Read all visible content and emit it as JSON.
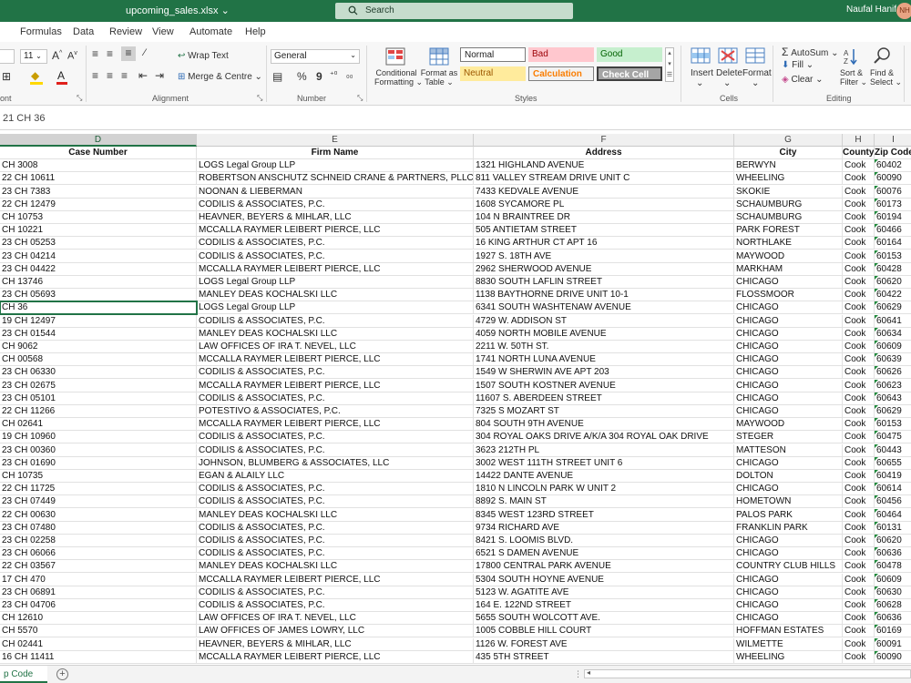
{
  "title_bar": {
    "file_name": "upcoming_sales.xlsx",
    "search_placeholder": "Search",
    "user_name": "Naufal Hanif",
    "user_initials": "NH"
  },
  "menu": [
    "Formulas",
    "Data",
    "Review",
    "View",
    "Automate",
    "Help"
  ],
  "ribbon": {
    "font_size": "11",
    "wrap_text": "Wrap Text",
    "merge_centre": "Merge & Centre",
    "number_format": "General",
    "currency_symbol": "%",
    "comma_symbol": "9",
    "conditional_formatting": [
      "Conditional",
      "Formatting"
    ],
    "format_as_table": [
      "Format as",
      "Table"
    ],
    "styles": {
      "normal": "Normal",
      "bad": "Bad",
      "good": "Good",
      "neutral": "Neutral",
      "calculation": "Calculation",
      "check_cell": "Check Cell"
    },
    "insert": "Insert",
    "delete": "Delete",
    "format": "Format",
    "autosum": "AutoSum",
    "fill": "Fill",
    "clear": "Clear",
    "sort_filter": [
      "Sort &",
      "Filter"
    ],
    "find_select": [
      "Find &",
      "Select"
    ],
    "groups": {
      "font": "ont",
      "alignment": "Alignment",
      "number": "Number",
      "styles": "Styles",
      "cells": "Cells",
      "editing": "Editing"
    }
  },
  "formula_bar": {
    "value": "21 CH 36"
  },
  "columns": [
    {
      "letter": "D",
      "header": "Case Number"
    },
    {
      "letter": "E",
      "header": "Firm Name"
    },
    {
      "letter": "F",
      "header": "Address"
    },
    {
      "letter": "G",
      "header": "City"
    },
    {
      "letter": "H",
      "header": "County"
    },
    {
      "letter": "I",
      "header": "Zip Code"
    }
  ],
  "rows": [
    [
      "CH 3008",
      "LOGS Legal Group LLP",
      "1321 HIGHLAND AVENUE",
      "BERWYN",
      "Cook",
      "60402"
    ],
    [
      "22 CH 10611",
      "ROBERTSON ANSCHUTZ SCHNEID CRANE & PARTNERS, PLLC",
      "811 VALLEY STREAM DRIVE UNIT C",
      "WHEELING",
      "Cook",
      "60090"
    ],
    [
      "23 CH 7383",
      "NOONAN & LIEBERMAN",
      "7433 KEDVALE AVENUE",
      "SKOKIE",
      "Cook",
      "60076"
    ],
    [
      "22 CH 12479",
      "CODILIS & ASSOCIATES, P.C.",
      "1608 SYCAMORE PL",
      "SCHAUMBURG",
      "Cook",
      "60173"
    ],
    [
      "CH 10753",
      "HEAVNER, BEYERS & MIHLAR, LLC",
      "104 N BRAINTREE DR",
      "SCHAUMBURG",
      "Cook",
      "60194"
    ],
    [
      "CH 10221",
      "MCCALLA RAYMER LEIBERT PIERCE, LLC",
      "505 ANTIETAM STREET",
      "PARK FOREST",
      "Cook",
      "60466"
    ],
    [
      "23 CH 05253",
      "CODILIS & ASSOCIATES, P.C.",
      "16 KING ARTHUR CT APT 16",
      "NORTHLAKE",
      "Cook",
      "60164"
    ],
    [
      "23 CH 04214",
      "CODILIS & ASSOCIATES, P.C.",
      "1927 S. 18TH AVE",
      "MAYWOOD",
      "Cook",
      "60153"
    ],
    [
      "23 CH 04422",
      "MCCALLA RAYMER LEIBERT PIERCE, LLC",
      "2962 SHERWOOD AVENUE",
      "MARKHAM",
      "Cook",
      "60428"
    ],
    [
      "CH 13746",
      "LOGS Legal Group LLP",
      "8830 SOUTH LAFLIN STREET",
      "CHICAGO",
      "Cook",
      "60620"
    ],
    [
      "23 CH 05693",
      "MANLEY DEAS KOCHALSKI LLC",
      "1138 BAYTHORNE DRIVE UNIT 10-1",
      "FLOSSMOOR",
      "Cook",
      "60422"
    ],
    [
      "CH 36",
      "LOGS Legal Group LLP",
      "6341 SOUTH WASHTENAW AVENUE",
      "CHICAGO",
      "Cook",
      "60629"
    ],
    [
      "19 CH 12497",
      "CODILIS & ASSOCIATES, P.C.",
      "4729 W. ADDISON ST",
      "CHICAGO",
      "Cook",
      "60641"
    ],
    [
      "23 CH 01544",
      "MANLEY DEAS KOCHALSKI LLC",
      "4059 NORTH MOBILE AVENUE",
      "CHICAGO",
      "Cook",
      "60634"
    ],
    [
      "CH 9062",
      "LAW OFFICES OF IRA T. NEVEL, LLC",
      "2211 W. 50TH ST.",
      "CHICAGO",
      "Cook",
      "60609"
    ],
    [
      "CH 00568",
      "MCCALLA RAYMER LEIBERT PIERCE, LLC",
      "1741 NORTH LUNA AVENUE",
      "CHICAGO",
      "Cook",
      "60639"
    ],
    [
      "23 CH 06330",
      "CODILIS & ASSOCIATES, P.C.",
      "1549 W SHERWIN AVE APT 203",
      "CHICAGO",
      "Cook",
      "60626"
    ],
    [
      "23 CH 02675",
      "MCCALLA RAYMER LEIBERT PIERCE, LLC",
      "1507 SOUTH KOSTNER AVENUE",
      "CHICAGO",
      "Cook",
      "60623"
    ],
    [
      "23 CH 05101",
      "CODILIS & ASSOCIATES, P.C.",
      "11607 S. ABERDEEN STREET",
      "CHICAGO",
      "Cook",
      "60643"
    ],
    [
      "22 CH 11266",
      "POTESTIVO & ASSOCIATES, P.C.",
      "7325 S MOZART ST",
      "CHICAGO",
      "Cook",
      "60629"
    ],
    [
      "CH 02641",
      "MCCALLA RAYMER LEIBERT PIERCE, LLC",
      "804 SOUTH 9TH AVENUE",
      "MAYWOOD",
      "Cook",
      "60153"
    ],
    [
      "19 CH 10960",
      "CODILIS & ASSOCIATES, P.C.",
      "304 ROYAL OAKS DRIVE A/K/A 304 ROYAL OAK DRIVE",
      "STEGER",
      "Cook",
      "60475"
    ],
    [
      "23 CH 00360",
      "CODILIS & ASSOCIATES, P.C.",
      "3623 212TH PL",
      "MATTESON",
      "Cook",
      "60443"
    ],
    [
      "23 CH 01690",
      "JOHNSON, BLUMBERG & ASSOCIATES, LLC",
      "3002 WEST 111TH STREET UNIT 6",
      "CHICAGO",
      "Cook",
      "60655"
    ],
    [
      "CH 10735",
      "EGAN & ALAILY LLC",
      "14422 DANTE AVENUE",
      "DOLTON",
      "Cook",
      "60419"
    ],
    [
      "22 CH 11725",
      "CODILIS & ASSOCIATES, P.C.",
      "1810 N LINCOLN PARK W UNIT 2",
      "CHICAGO",
      "Cook",
      "60614"
    ],
    [
      "23 CH 07449",
      "CODILIS & ASSOCIATES, P.C.",
      "8892 S. MAIN ST",
      "HOMETOWN",
      "Cook",
      "60456"
    ],
    [
      "22 CH 00630",
      "MANLEY DEAS KOCHALSKI LLC",
      "8345 WEST 123RD STREET",
      "PALOS PARK",
      "Cook",
      "60464"
    ],
    [
      "23 CH 07480",
      "CODILIS & ASSOCIATES, P.C.",
      "9734 RICHARD AVE",
      "FRANKLIN PARK",
      "Cook",
      "60131"
    ],
    [
      "23 CH 02258",
      "CODILIS & ASSOCIATES, P.C.",
      "8421 S. LOOMIS BLVD.",
      "CHICAGO",
      "Cook",
      "60620"
    ],
    [
      "23 CH 06066",
      "CODILIS & ASSOCIATES, P.C.",
      "6521 S DAMEN AVENUE",
      "CHICAGO",
      "Cook",
      "60636"
    ],
    [
      "22 CH 03567",
      "MANLEY DEAS KOCHALSKI LLC",
      "17800 CENTRAL PARK AVENUE",
      "COUNTRY CLUB HILLS",
      "Cook",
      "60478"
    ],
    [
      "17 CH 470",
      "MCCALLA RAYMER LEIBERT PIERCE, LLC",
      "5304 SOUTH HOYNE AVENUE",
      "CHICAGO",
      "Cook",
      "60609"
    ],
    [
      "23 CH 06891",
      "CODILIS & ASSOCIATES, P.C.",
      "5123 W. AGATITE AVE",
      "CHICAGO",
      "Cook",
      "60630"
    ],
    [
      "23 CH 04706",
      "CODILIS & ASSOCIATES, P.C.",
      "164 E. 122ND STREET",
      "CHICAGO",
      "Cook",
      "60628"
    ],
    [
      "CH 12610",
      "LAW OFFICES OF IRA T. NEVEL, LLC",
      "5655 SOUTH WOLCOTT AVE.",
      "CHICAGO",
      "Cook",
      "60636"
    ],
    [
      "CH 5570",
      "LAW OFFICES OF JAMES LOWRY, LLC",
      "1005 COBBLE HILL COURT",
      "HOFFMAN ESTATES",
      "Cook",
      "60169"
    ],
    [
      "CH 02441",
      "HEAVNER, BEYERS & MIHLAR, LLC",
      "1126 W. FOREST AVE",
      "WILMETTE",
      "Cook",
      "60091"
    ],
    [
      "16 CH 11411",
      "MCCALLA RAYMER LEIBERT PIERCE, LLC",
      "435 5TH STREET",
      "WHEELING",
      "Cook",
      "60090"
    ]
  ],
  "selected_row_index": 11,
  "sheet_tab": "p Code"
}
